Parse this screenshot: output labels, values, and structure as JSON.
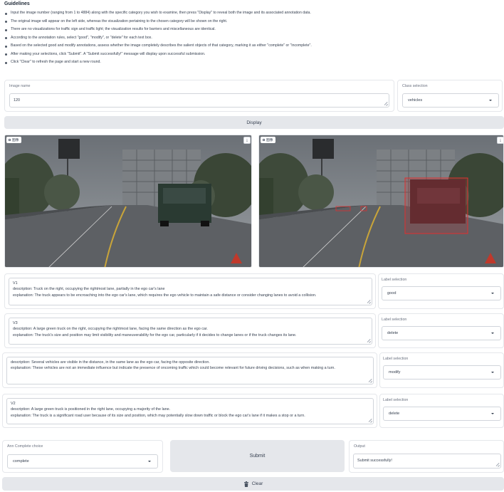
{
  "guidelines": {
    "title": "Guidelines",
    "items": [
      "Input the image number (ranging from 1 to 4884) along with the specific category you wish to examine, then press \"Display\" to reveal both the image and its associated annotation data.",
      "The original image will appear on the left side, whereas the visualization pertaining to the chosen category will be shown on the right.",
      "There are no visualizations for traffic sign and traffic light; the visualization results for barriers and miscellaneous are identical.",
      "According to the annotation rules, select \"good\", \"modify\", or \"delete\" for each text box.",
      "Based on the selected good and modify annotations, assess whether the image completely describes the salient objects of that category, marking it as either \"complete\" or \"incomplete\".",
      "After making your selections, click \"Submit\". A \"Submit successfully!\" message will display upon successful submission.",
      "Click \"Clear\" to refresh the page and start a new round."
    ]
  },
  "image_name": {
    "label": "Image name",
    "value": "120"
  },
  "class_selection": {
    "label": "Class selection",
    "value": "vehicles"
  },
  "display_button": "Display",
  "image_panels": {
    "left_tag": "图像",
    "right_tag": "图像",
    "download_icon": "download-icon"
  },
  "annotations": [
    {
      "id_line": "V1",
      "description": "description: Truck on the right, occupying the rightmost lane, partially in the ego car's lane",
      "explanation": "explanation: The truck appears to be encroaching into the ego car's lane, which requires the ego vehicle to maintain a safe distance or consider changing lanes to avoid a collision.",
      "label_title": "Label selection",
      "label_value": "good"
    },
    {
      "id_line": "V3",
      "description": "description: A large green truck on the right, occupying the rightmost lane, facing the same direction as the ego car.",
      "explanation": "explanation: The truck's size and position may limit visibility and maneuverability for the ego car, particularly if it decides to change lanes or if the truck changes its lane.",
      "label_title": "Label selection",
      "label_value": "delete"
    },
    {
      "id_line": "",
      "description": "description: Several vehicles are visible in the distance, in the same lane as the ego car, facing the opposite direction.",
      "explanation": "explanation: These vehicles are not an immediate influence but indicate the presence of oncoming traffic which could become relevant for future driving decisions, such as when making a turn.",
      "label_title": "Label selection",
      "label_value": "modify"
    },
    {
      "id_line": "V2",
      "description": "description: A large green truck is positioned in the right lane, occupying a majority of the lane.",
      "explanation": "explanation: The truck is a significant road user because of its size and position, which may potentially slow down traffic or block the ego car's lane if it makes a stop or a turn.",
      "label_title": "Label selection",
      "label_value": "delete"
    }
  ],
  "ann_complete": {
    "label": "Ann Complete choice",
    "value": "complete"
  },
  "submit_button": "Submit",
  "output": {
    "label": "Output",
    "value": "Submit successfully!"
  },
  "clear_button": {
    "label": "Clear",
    "icon": "trash-icon"
  }
}
